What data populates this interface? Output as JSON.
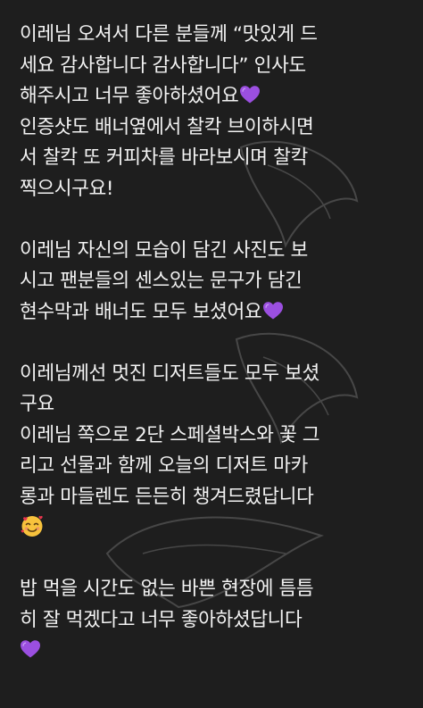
{
  "message": {
    "lines_p1": [
      "이레님 오셔서 다른 분들께 “맛있게 드",
      "세요 감사합니다 감사합니다” 인사도",
      "해주시고 너무 좋아하셨어요",
      "인증샷도 배너옆에서 찰칵 브이하시면",
      "서 찰칵 또 커피차를 바라보시며 찰칵",
      "찍으시구요!"
    ],
    "lines_p2": [
      "이레님 자신의 모습이 담긴 사진도 보",
      "시고 팬분들의 센스있는 문구가 담긴",
      "현수막과 배너도 모두 보셨어요"
    ],
    "lines_p3": [
      "이레님께선 멋진 디저트들도 모두 보셨",
      "구요",
      "이레님 쪽으로 2단 스페셜박스와 꽃 그",
      "리고 선물과 함께 오늘의 디저트 마카",
      "롱과 마들렌도 든든히 챙겨드렸답니다"
    ],
    "lines_p4": [
      "밥 먹을 시간도 없는 바쁜 현장에 틈틈",
      "히 잘 먹겠다고 너무 좋아하셨답니다"
    ]
  },
  "emoji": {
    "purple_heart": "purple-heart-icon",
    "smiling_face_with_hearts": "smiling-face-with-hearts-icon"
  },
  "colors": {
    "background": "#1e1e1e",
    "text": "#f2f2f2",
    "heart": "#9b4fe0"
  }
}
